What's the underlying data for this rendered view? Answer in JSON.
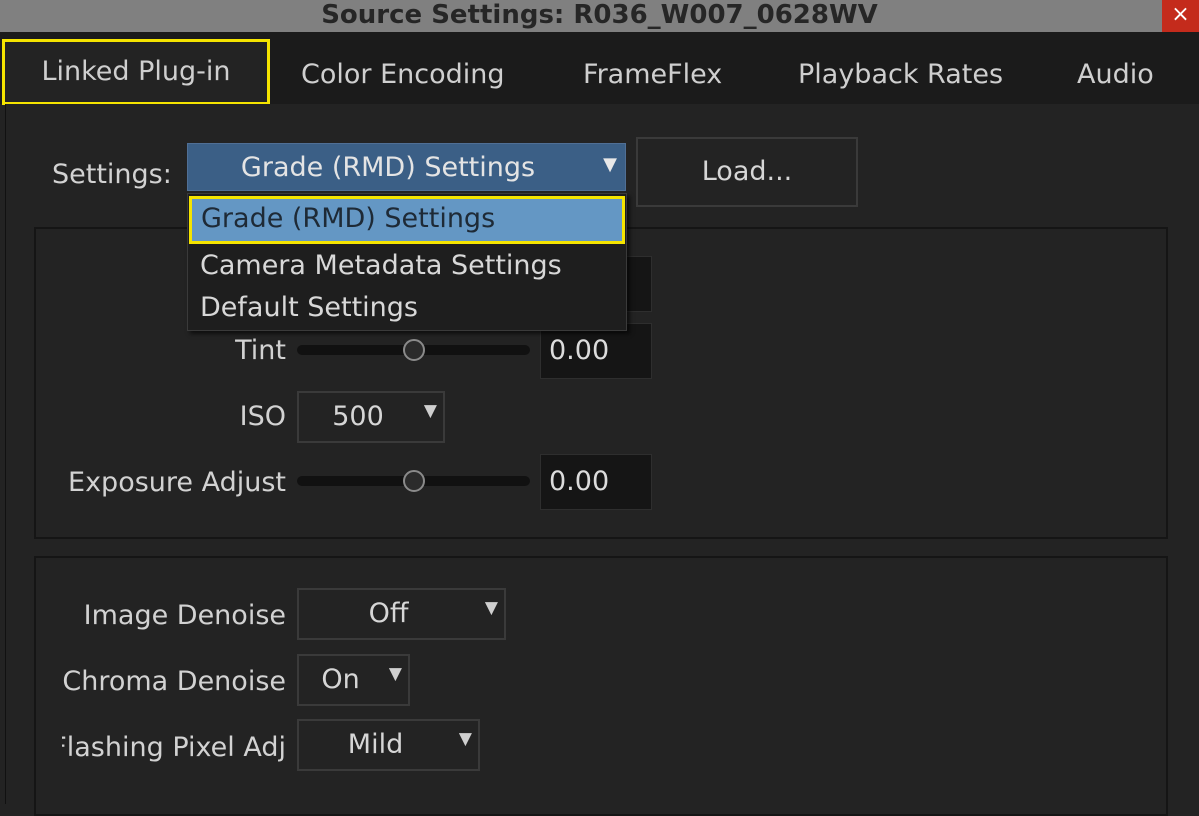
{
  "window": {
    "title": "Source Settings: R036_W007_0628WV",
    "close_glyph": "×"
  },
  "tabs": [
    {
      "label": "Linked Plug-in",
      "active": true
    },
    {
      "label": "Color Encoding",
      "active": false
    },
    {
      "label": "FrameFlex",
      "active": false
    },
    {
      "label": "Playback Rates",
      "active": false
    },
    {
      "label": "Audio",
      "active": false
    }
  ],
  "settings": {
    "label": "Settings:",
    "selected": "Grade (RMD) Settings",
    "options": [
      "Grade (RMD) Settings",
      "Camera Metadata Settings",
      "Default Settings"
    ],
    "load_button": "Load..."
  },
  "grade": {
    "tint": {
      "label": "Tint",
      "value": "0.00",
      "slider_fraction": 0.5
    },
    "iso": {
      "label": "ISO",
      "value": "500"
    },
    "exposure": {
      "label": "Exposure Adjust",
      "value": "0.00",
      "slider_fraction": 0.5
    }
  },
  "denoise": {
    "image_denoise": {
      "label": "Image Denoise",
      "value": "Off"
    },
    "chroma_denoise": {
      "label": "Chroma Denoise",
      "value": "On"
    },
    "flashing_pixel": {
      "label": "Flashing Pixel Adj",
      "value": "Mild"
    }
  },
  "icons": {
    "dropdown_arrow": "▼"
  },
  "colors": {
    "accent_highlight": "#f5e400",
    "selection_blue": "#6497c4",
    "select_fill": "#3b5f86",
    "close_red": "#c42b1c"
  }
}
